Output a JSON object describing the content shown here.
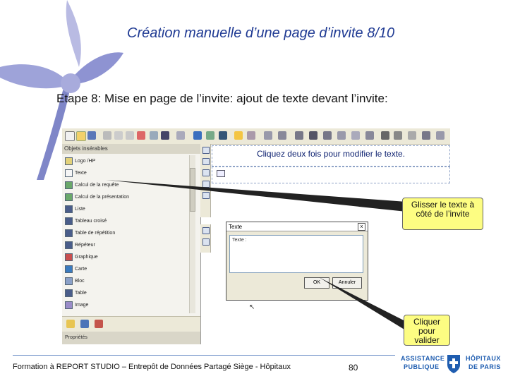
{
  "slide": {
    "title": "Création manuelle d’une page d’invite 8/10",
    "subtitle": "Etape 8: Mise en page de l’invite: ajout de texte devant l’invite:"
  },
  "screenshot": {
    "left_pane": {
      "header": "Objets insérables",
      "items": [
        {
          "label": "Logo /HP",
          "icon": "image-icon"
        },
        {
          "label": "Texte",
          "icon": "text-icon"
        },
        {
          "label": "Calcul de la requête",
          "icon": "calculation-icon"
        },
        {
          "label": "Calcul de la présentation",
          "icon": "calculation-icon"
        },
        {
          "label": "Liste",
          "icon": "list-icon"
        },
        {
          "label": "Tableau croisé",
          "icon": "crosstab-icon"
        },
        {
          "label": "Table de répétition",
          "icon": "repeater-table-icon"
        },
        {
          "label": "Répéteur",
          "icon": "repeater-icon"
        },
        {
          "label": "Graphique",
          "icon": "chart-icon"
        },
        {
          "label": "Carte",
          "icon": "map-icon"
        },
        {
          "label": "Bloc",
          "icon": "block-icon"
        },
        {
          "label": "Table",
          "icon": "table-icon"
        },
        {
          "label": "Image",
          "icon": "image-icon"
        }
      ],
      "footer": "Propriétés"
    },
    "canvas_text": "Cliquez deux fois pour modifier le texte.",
    "dialog": {
      "title": "Texte",
      "close": "x",
      "content": "Texte :",
      "ok": "OK",
      "cancel": "Annuler"
    }
  },
  "callouts": {
    "drag": "Glisser le texte à côté de l’invite",
    "validate": "Cliquer pour valider"
  },
  "footer": {
    "text": "Formation à REPORT STUDIO – Entrepôt de Données Partagé Siège - Hôpitaux",
    "page": "80"
  },
  "logo": {
    "left_line1": "ASSISTANCE",
    "left_line2": "PUBLIQUE",
    "right_line1": "HÔPITAUX",
    "right_line2": "DE PARIS"
  },
  "colors": {
    "title": "#1f3a93",
    "callout_bg": "#fdfd82",
    "decoration": "#7f86c8",
    "line": "#6c8fc7"
  }
}
